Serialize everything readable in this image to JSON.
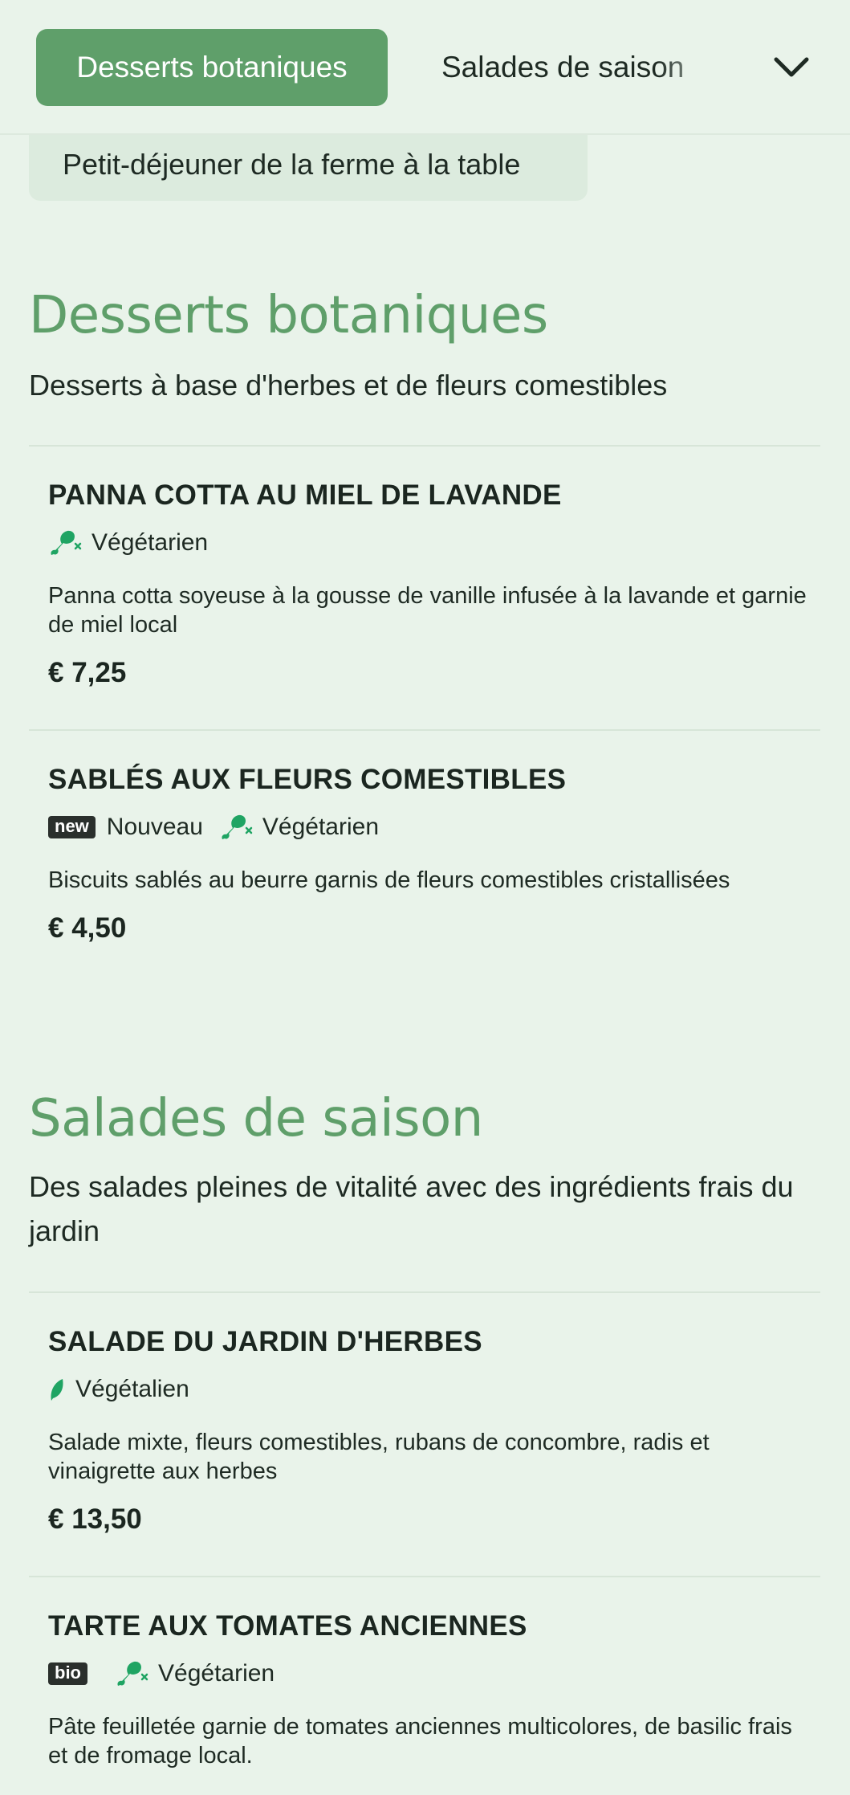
{
  "nav": {
    "active_tab": "Desserts botaniques",
    "next_tab": "Salades de saison",
    "overflow_tab": "Petit-déjeuner de la ferme à la table",
    "expand_icon": "chevron-down-icon"
  },
  "colors": {
    "accent": "#5f9f6a",
    "background": "#e9f3ea",
    "icon_green": "#1fa463",
    "badge_bg": "#2a2f2c"
  },
  "sections": [
    {
      "title": "Desserts botaniques",
      "description": "Desserts à base d'herbes et de fleurs comestibles",
      "items": [
        {
          "name": "PANNA COTTA AU MIEL DE LAVANDE",
          "tags": [
            {
              "icon": "no-meat-icon",
              "label": "Végétarien"
            }
          ],
          "description": "Panna cotta soyeuse à la gousse de vanille infusée à la lavande et garnie de miel local",
          "price": "€ 7,25"
        },
        {
          "name": "SABLÉS AUX FLEURS COMESTIBLES",
          "tags": [
            {
              "badge": "new",
              "label": "Nouveau"
            },
            {
              "icon": "no-meat-icon",
              "label": "Végétarien"
            }
          ],
          "description": "Biscuits sablés au beurre garnis de fleurs comestibles cristallisées",
          "price": "€ 4,50"
        }
      ]
    },
    {
      "title": "Salades de saison",
      "description": "Des salades pleines de vitalité avec des ingrédients frais du jardin",
      "items": [
        {
          "name": "SALADE DU JARDIN D'HERBES",
          "tags": [
            {
              "icon": "leaf-icon",
              "label": "Végétalien"
            }
          ],
          "description": "Salade mixte, fleurs comestibles, rubans de concombre, radis et vinaigrette aux herbes",
          "price": "€ 13,50"
        },
        {
          "name": "TARTE AUX TOMATES ANCIENNES",
          "tags": [
            {
              "badge": "bio"
            },
            {
              "icon": "no-meat-icon",
              "label": "Végétarien"
            }
          ],
          "description": "Pâte feuilletée garnie de tomates anciennes multicolores, de basilic frais et de fromage local."
        }
      ]
    }
  ]
}
